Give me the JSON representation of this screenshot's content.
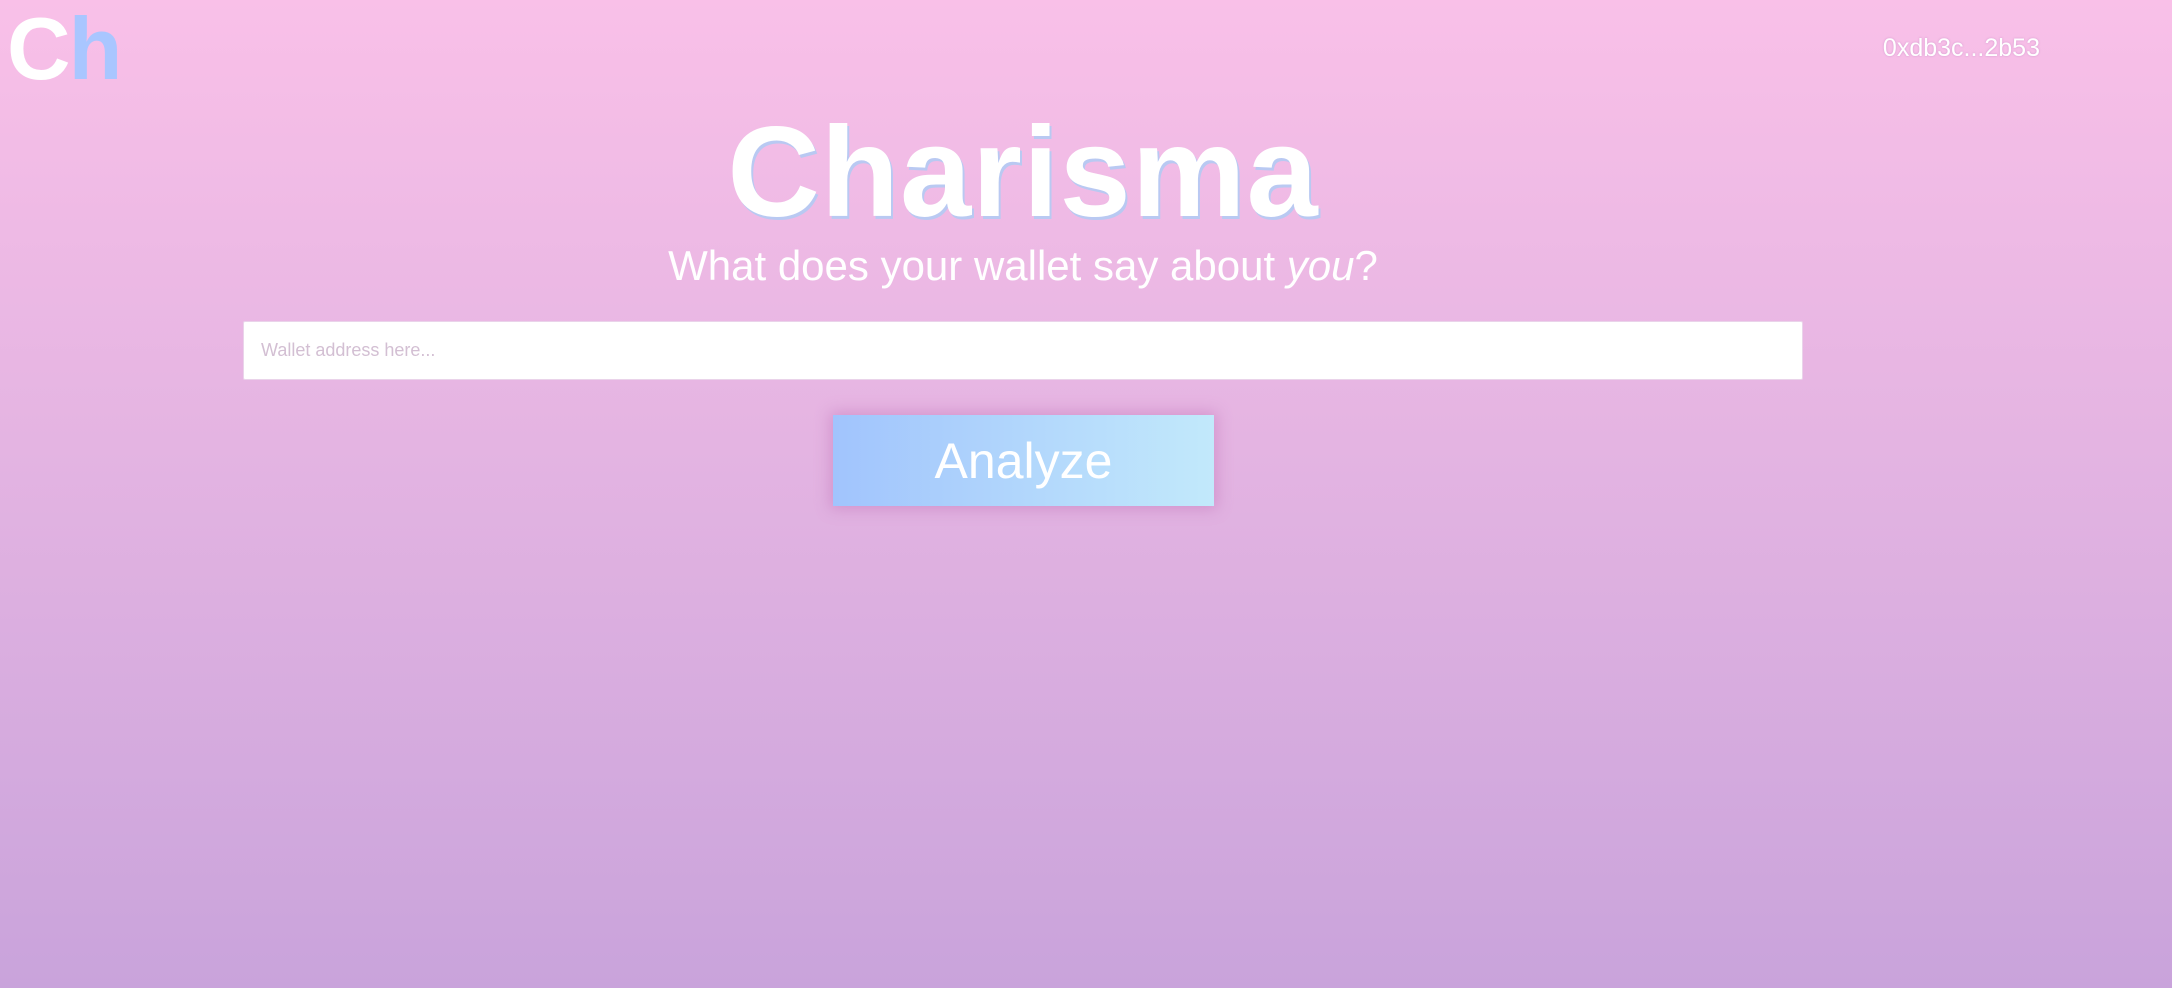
{
  "logo": {
    "first_letter": "C",
    "second_letter": "h"
  },
  "header": {
    "wallet_address": "0xdb3c...2b53"
  },
  "hero": {
    "title": "Charisma",
    "subtitle_prefix": "What does your wallet say about ",
    "subtitle_emphasis": "you",
    "subtitle_suffix": "?"
  },
  "search": {
    "value": "",
    "placeholder": "Wallet address here..."
  },
  "actions": {
    "analyze_label": "Analyze"
  },
  "colors": {
    "background_top": "#f9c0e8",
    "background_bottom": "#c9a3db",
    "logo_accent": "#a9c6ff",
    "button_gradient_start": "#a1c4fd",
    "button_gradient_end": "#c2e9fb"
  }
}
